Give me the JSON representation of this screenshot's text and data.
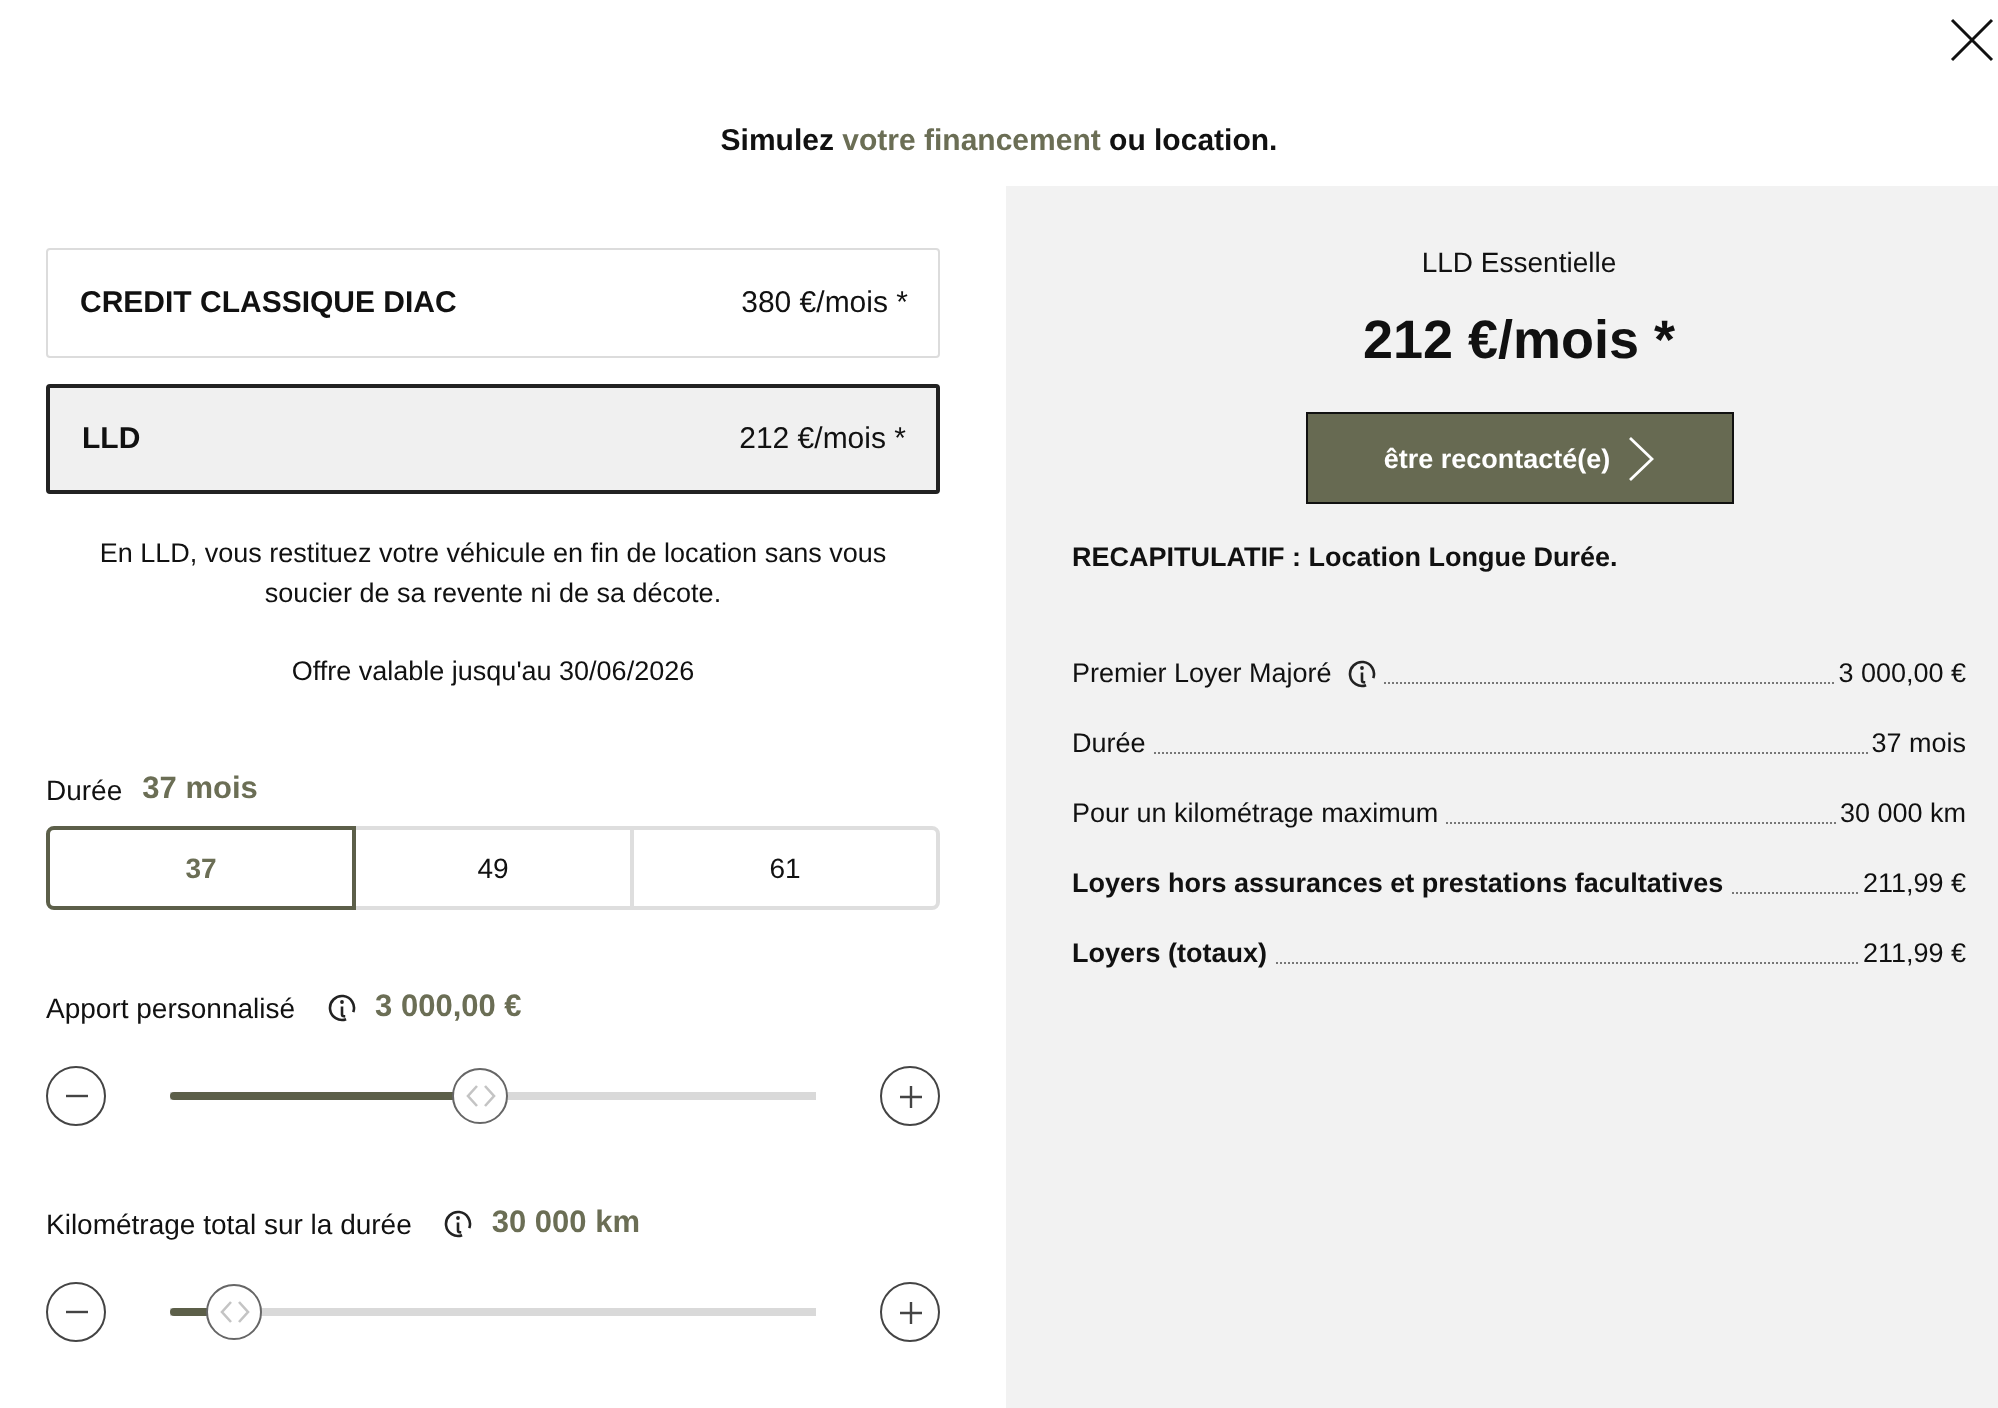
{
  "title": {
    "lead": "Simulez ",
    "highlight": "votre financement",
    "tail": " ou location."
  },
  "offers": [
    {
      "name": "CREDIT CLASSIQUE DIAC",
      "price": "380 €/mois *",
      "selected": false
    },
    {
      "name": "LLD",
      "price": "212 €/mois *",
      "selected": true
    }
  ],
  "description": "En LLD, vous restituez votre véhicule en fin de location sans vous soucier de sa revente ni de sa décote.",
  "validity": "Offre valable jusqu'au 30/06/2026",
  "duration": {
    "label": "Durée",
    "value": "37 mois",
    "options": [
      {
        "label": "37",
        "selected": true
      },
      {
        "label": "49",
        "selected": false
      },
      {
        "label": "61",
        "selected": false
      }
    ]
  },
  "sliders": [
    {
      "label": "Apport personnalisé",
      "info": true,
      "value": "3 000,00 €",
      "level": 0.48
    },
    {
      "label": "Kilométrage total sur la durée",
      "info": true,
      "value": "30 000 km",
      "level": 0.1
    }
  ],
  "summary": {
    "plan": "LLD Essentielle",
    "price": "212 €/mois *",
    "button": "être recontacté(e)",
    "heading": "RECAPITULATIF : Location Longue Durée.",
    "rows": [
      {
        "label": "Premier Loyer Majoré",
        "info": true,
        "value": "3 000,00 €",
        "emphasized": false
      },
      {
        "label": "Durée",
        "info": false,
        "value": "37 mois",
        "emphasized": false
      },
      {
        "label": "Pour un kilométrage maximum",
        "info": false,
        "value": "30 000 km",
        "emphasized": false
      },
      {
        "label": "Loyers hors assurances et prestations facultatives",
        "info": false,
        "value": "211,99 €",
        "emphasized": true
      },
      {
        "label": "Loyers (totaux)",
        "info": false,
        "value": "211,99 €",
        "emphasized": true
      }
    ]
  }
}
